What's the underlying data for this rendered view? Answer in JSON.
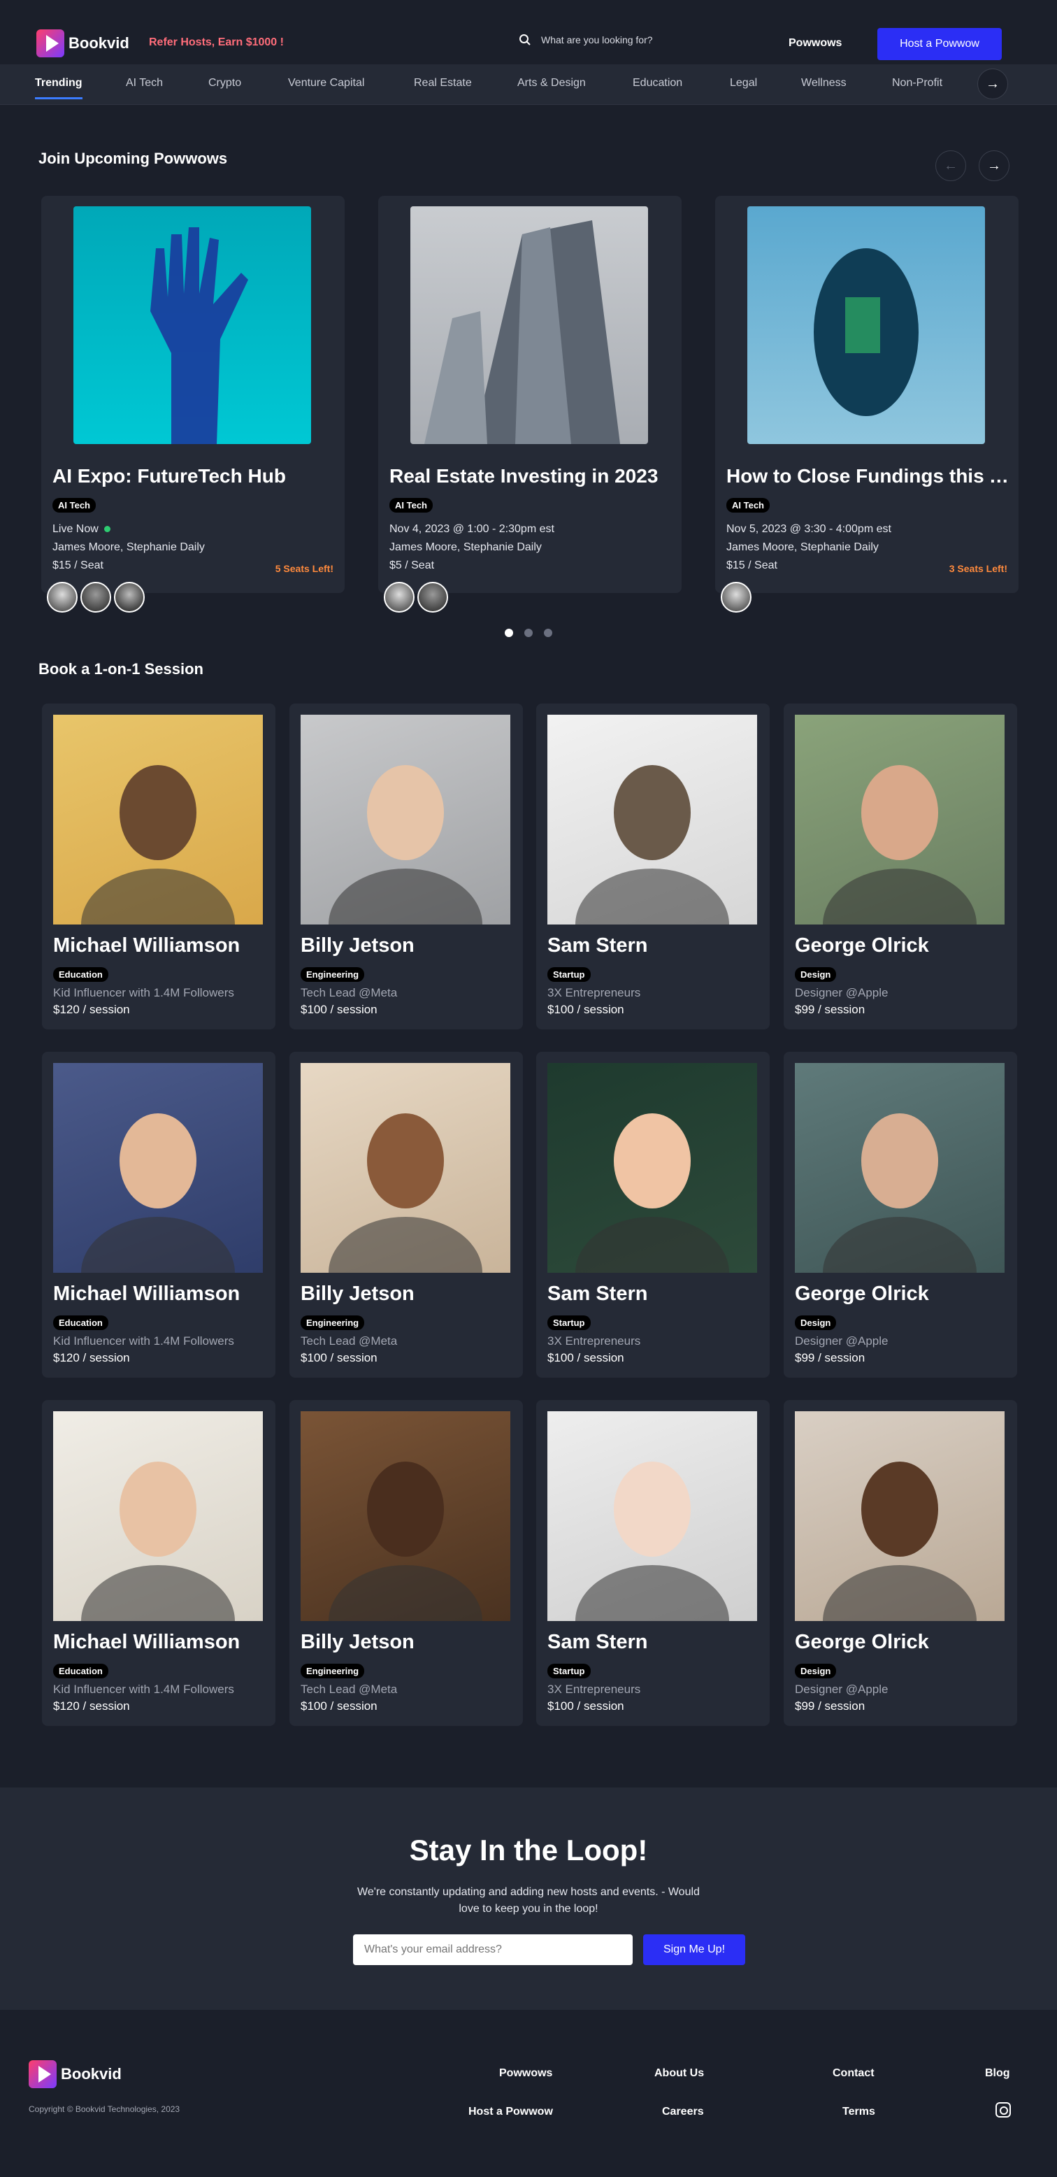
{
  "header": {
    "logo_text": "Bookvid",
    "refer_text": "Refer Hosts, Earn $1000 !",
    "search_placeholder": "What are you looking for?",
    "nav_powwows": "Powwows",
    "host_button": "Host a Powwow",
    "icons": {
      "search": "search-icon",
      "logo": "play-triangle-icon"
    },
    "colors": {
      "accent": "#2b2ef5",
      "refer": "#ff6d7a",
      "background": "#1b1f2a"
    }
  },
  "categories": [
    "Trending",
    "AI Tech",
    "Crypto",
    "Venture Capital",
    "Real Estate",
    "Arts & Design",
    "Education",
    "Legal",
    "Wellness",
    "Non-Profit"
  ],
  "powwows": {
    "title": "Join Upcoming Powwows",
    "items": [
      {
        "title": "AI Expo: FutureTech Hub",
        "tag": "AI Tech",
        "when": "Live Now",
        "hosts": "James Moore, Stephanie Daily",
        "price": "$15 / Seat",
        "seats": "5 Seats Left!"
      },
      {
        "title": "Real Estate Investing in 2023",
        "tag": "AI Tech",
        "when": "Nov 4, 2023 @ 1:00 - 2:30pm est",
        "hosts": "James Moore, Stephanie Daily",
        "price": "$5 / Seat",
        "seats": ""
      },
      {
        "title": "How to Close Fundings this Year",
        "tag": "AI Tech",
        "when": "Nov 5, 2023 @ 3:30 - 4:00pm est",
        "hosts": "James Moore, Stephanie Daily",
        "price": "$15 / Seat",
        "seats": "3 Seats Left!"
      }
    ],
    "carousel_page": 1,
    "carousel_pages": 3
  },
  "sessions": {
    "title": "Book a 1-on-1 Session",
    "items": [
      {
        "name": "Michael Williamson",
        "tag": "Education",
        "role": "Kid Influencer with 1.4M Followers",
        "price": "$120 / session"
      },
      {
        "name": "Billy Jetson",
        "tag": "Engineering",
        "role": "Tech Lead @Meta",
        "price": "$100 / session"
      },
      {
        "name": "Sam Stern",
        "tag": "Startup",
        "role": "3X Entrepreneurs",
        "price": "$100 / session"
      },
      {
        "name": "George Olrick",
        "tag": "Design",
        "role": "Designer @Apple",
        "price": "$99 / session"
      },
      {
        "name": "Michael Williamson",
        "tag": "Education",
        "role": "Kid Influencer with 1.4M Followers",
        "price": "$120 / session"
      },
      {
        "name": "Billy Jetson",
        "tag": "Engineering",
        "role": "Tech Lead @Meta",
        "price": "$100 / session"
      },
      {
        "name": "Sam Stern",
        "tag": "Startup",
        "role": "3X Entrepreneurs",
        "price": "$100 / session"
      },
      {
        "name": "George Olrick",
        "tag": "Design",
        "role": "Designer @Apple",
        "price": "$99 / session"
      },
      {
        "name": "Michael Williamson",
        "tag": "Education",
        "role": "Kid Influencer with 1.4M Followers",
        "price": "$120 / session"
      },
      {
        "name": "Billy Jetson",
        "tag": "Engineering",
        "role": "Tech Lead @Meta",
        "price": "$100 / session"
      },
      {
        "name": "Sam Stern",
        "tag": "Startup",
        "role": "3X Entrepreneurs",
        "price": "$100 / session"
      },
      {
        "name": "George Olrick",
        "tag": "Design",
        "role": "Designer @Apple",
        "price": "$99 / session"
      }
    ]
  },
  "newsletter": {
    "title": "Stay In the Loop!",
    "text": "We're constantly updating and adding new hosts and events. - Would love to keep you in the loop!",
    "placeholder": "What's your email address?",
    "button": "Sign Me Up!"
  },
  "footer": {
    "logo_text": "Bookvid",
    "copyright": "Copyright © Bookvid Technologies, 2023",
    "links": [
      "Powwows",
      "About Us",
      "Contact",
      "Blog",
      "Host a Powwow",
      "Careers",
      "Terms"
    ],
    "social_icon": "instagram-icon"
  }
}
